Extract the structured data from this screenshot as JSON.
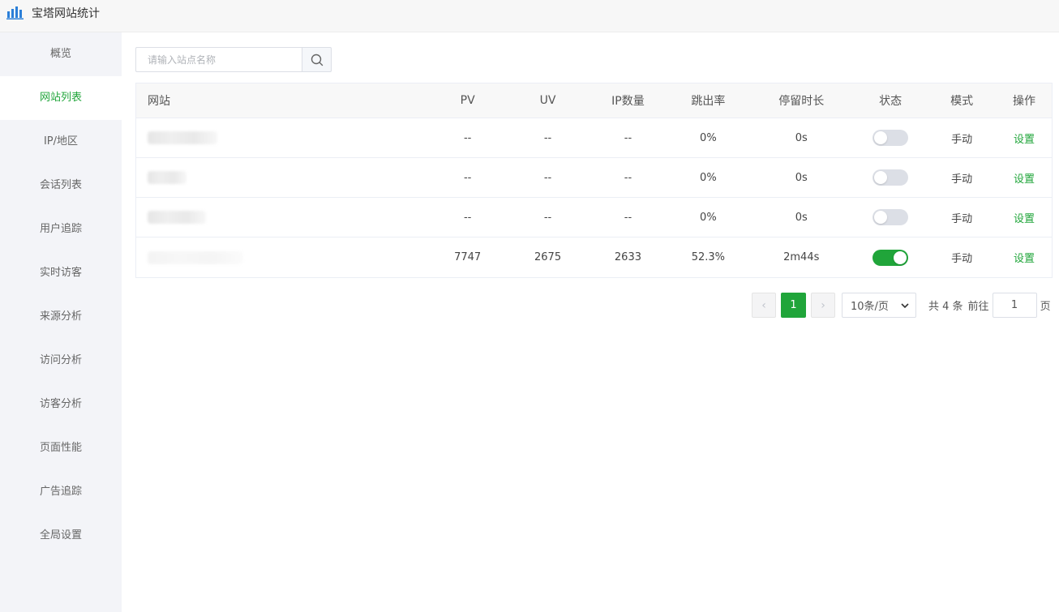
{
  "app": {
    "title": "宝塔网站统计",
    "icon": "bar-chart-icon"
  },
  "sidebar": {
    "items": [
      {
        "label": "概览",
        "active": false
      },
      {
        "label": "网站列表",
        "active": true
      },
      {
        "label": "IP/地区",
        "active": false
      },
      {
        "label": "会话列表",
        "active": false
      },
      {
        "label": "用户追踪",
        "active": false
      },
      {
        "label": "实时访客",
        "active": false
      },
      {
        "label": "来源分析",
        "active": false
      },
      {
        "label": "访问分析",
        "active": false
      },
      {
        "label": "访客分析",
        "active": false
      },
      {
        "label": "页面性能",
        "active": false
      },
      {
        "label": "广告追踪",
        "active": false
      },
      {
        "label": "全局设置",
        "active": false
      }
    ]
  },
  "search": {
    "placeholder": "请输入站点名称",
    "value": "",
    "icon": "search-icon"
  },
  "table": {
    "headers": {
      "site": "网站",
      "pv": "PV",
      "uv": "UV",
      "ip": "IP数量",
      "bounce": "跳出率",
      "stay": "停留时长",
      "status": "状态",
      "mode": "模式",
      "op": "操作"
    },
    "rows": [
      {
        "site": "",
        "pv": "--",
        "uv": "--",
        "ip": "--",
        "bounce": "0%",
        "stay": "0s",
        "status_on": false,
        "mode": "手动",
        "op": "设置"
      },
      {
        "site": "",
        "pv": "--",
        "uv": "--",
        "ip": "--",
        "bounce": "0%",
        "stay": "0s",
        "status_on": false,
        "mode": "手动",
        "op": "设置"
      },
      {
        "site": "",
        "pv": "--",
        "uv": "--",
        "ip": "--",
        "bounce": "0%",
        "stay": "0s",
        "status_on": false,
        "mode": "手动",
        "op": "设置"
      },
      {
        "site": "",
        "pv": "7747",
        "uv": "2675",
        "ip": "2633",
        "bounce": "52.3%",
        "stay": "2m44s",
        "status_on": true,
        "mode": "手动",
        "op": "设置"
      }
    ]
  },
  "pagination": {
    "prev": "‹",
    "next": "›",
    "current_page": "1",
    "page_size": "10条/页",
    "total": "共 4 条",
    "goto_label": "前往",
    "goto_value": "1",
    "goto_unit": "页"
  },
  "colors": {
    "accent": "#20a53a",
    "sidebar_bg": "#f3f4f8"
  }
}
